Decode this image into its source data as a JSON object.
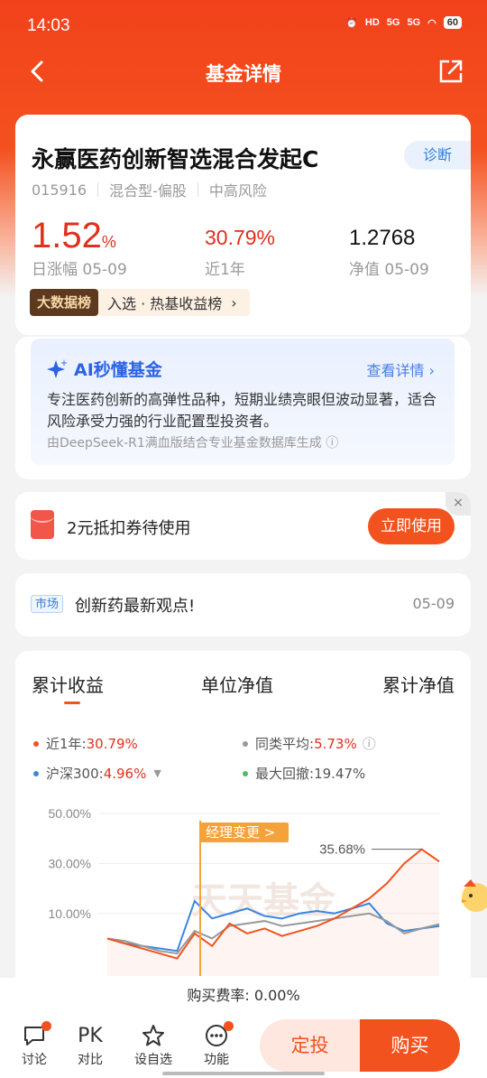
{
  "status": {
    "time": "14:03",
    "battery": "60",
    "net1": "5G",
    "net2": "5G",
    "hd": "HD"
  },
  "nav": {
    "title": "基金详情"
  },
  "fund": {
    "name": "永赢医药创新智选混合发起C",
    "diagnose": "诊断",
    "code": "015916",
    "type": "混合型-偏股",
    "risk": "中高风险",
    "daily_change": "1.52",
    "daily_change_unit": "%",
    "daily_label": "日涨幅 05-09",
    "year_return": "30.79%",
    "year_label": "近1年",
    "nav_value": "1.2768",
    "nav_label": "净值 05-09",
    "bigdata_badge": "大数据榜",
    "bigdata_text": "入选 · 热基收益榜"
  },
  "ai": {
    "title": "AI秒懂基金",
    "link": "查看详情",
    "text": "专注医药创新的高弹性品种，短期业绩亮眼但波动显著，适合风险承受力强的行业配置型投资者。",
    "foot": "由DeepSeek-R1满血版结合专业基金数据库生成"
  },
  "coupon": {
    "text": "2元抵扣券待使用",
    "button": "立即使用",
    "close": "×"
  },
  "news": {
    "tag": "市场",
    "title": "创新药最新观点!",
    "date": "05-09"
  },
  "chart_tabs": [
    "累计收益",
    "单位净值",
    "累计净值"
  ],
  "legend": {
    "fund_label": "近1年:",
    "fund_value": "30.79%",
    "peer_label": "同类平均:",
    "peer_value": "5.73%",
    "index_label": "沪深300:",
    "index_value": "4.96%",
    "dd_label": "最大回撤:",
    "dd_value": "19.47%"
  },
  "colors": {
    "fund": "#f0531e",
    "peer": "#999999",
    "index": "#3a86e0",
    "drawdown": "#4cbf5a",
    "accent": "#f2521d"
  },
  "chart_data": {
    "type": "line",
    "yticks": [
      "50.00%",
      "30.00%",
      "10.00%"
    ],
    "ylim": [
      10,
      50
    ],
    "annotation_manager": "经理变更 >",
    "annotation_max": "35.68%",
    "watermark": "天天基金",
    "series": [
      {
        "name": "近1年",
        "values": [
          0,
          -2,
          -4,
          -6,
          -8,
          2,
          -3,
          6,
          2,
          4,
          1,
          3,
          5,
          8,
          12,
          16,
          22,
          30,
          35.68,
          30.79
        ]
      },
      {
        "name": "同类平均",
        "values": [
          0,
          -1,
          -3,
          -5,
          -6,
          3,
          0,
          5,
          6,
          7,
          5,
          6,
          7,
          8,
          9,
          10,
          7,
          2,
          4,
          5.73
        ]
      },
      {
        "name": "沪深300",
        "values": [
          0,
          -2,
          -3,
          -4,
          -5,
          15,
          8,
          10,
          12,
          9,
          8,
          10,
          11,
          10,
          12,
          14,
          6,
          3,
          4,
          4.96
        ]
      }
    ]
  },
  "fee": {
    "text": "购买费率: 0.00%"
  },
  "bottom": {
    "discuss": "讨论",
    "compare": "对比",
    "compare_icon": "PK",
    "watch": "设自选",
    "func": "功能",
    "ding": "定投",
    "buy": "购买"
  }
}
